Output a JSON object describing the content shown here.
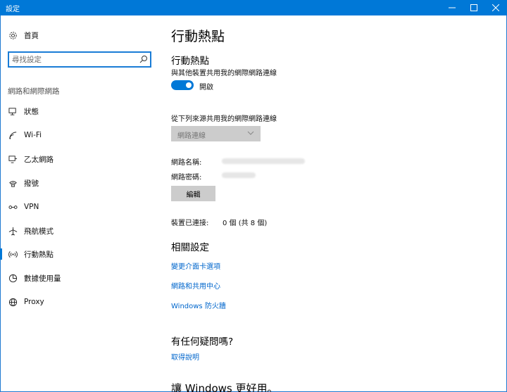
{
  "window": {
    "title": "設定",
    "colors": {
      "accent": "#0078d7",
      "link": "#0066cc",
      "button_bg": "#cccccc"
    }
  },
  "sidebar": {
    "home_label": "首頁",
    "search_placeholder": "尋找設定",
    "section_label": "網路和網際網路",
    "items": [
      {
        "label": "狀態",
        "icon": "status-icon",
        "active": false
      },
      {
        "label": "Wi-Fi",
        "icon": "wifi-icon",
        "active": false
      },
      {
        "label": "乙太網路",
        "icon": "ethernet-icon",
        "active": false
      },
      {
        "label": "撥號",
        "icon": "dialup-icon",
        "active": false
      },
      {
        "label": "VPN",
        "icon": "vpn-icon",
        "active": false
      },
      {
        "label": "飛航模式",
        "icon": "airplane-icon",
        "active": false
      },
      {
        "label": "行動熱點",
        "icon": "hotspot-icon",
        "active": true
      },
      {
        "label": "數據使用量",
        "icon": "data-usage-icon",
        "active": false
      },
      {
        "label": "Proxy",
        "icon": "globe-icon",
        "active": false
      }
    ]
  },
  "main": {
    "page_title": "行動熱點",
    "hotspot_heading": "行動熱點",
    "share_desc": "與其他裝置共用我的網際網路連線",
    "toggle_state": "開啟",
    "source_label": "從下列來源共用我的網際網路連線",
    "source_value": "網路連線",
    "network_name_label": "網路名稱:",
    "network_password_label": "網路密碼:",
    "edit_button": "編輯",
    "devices_connected_label": "裝置已連接:",
    "devices_connected_value": "0 個 (共 8 個)",
    "related_heading": "相關設定",
    "links": [
      "變更介面卡選項",
      "網路和共用中心",
      "Windows 防火牆"
    ],
    "question_heading": "有任何疑問嗎?",
    "help_link": "取得說明",
    "bottom_heading": "讓 Windows 更好用。"
  }
}
